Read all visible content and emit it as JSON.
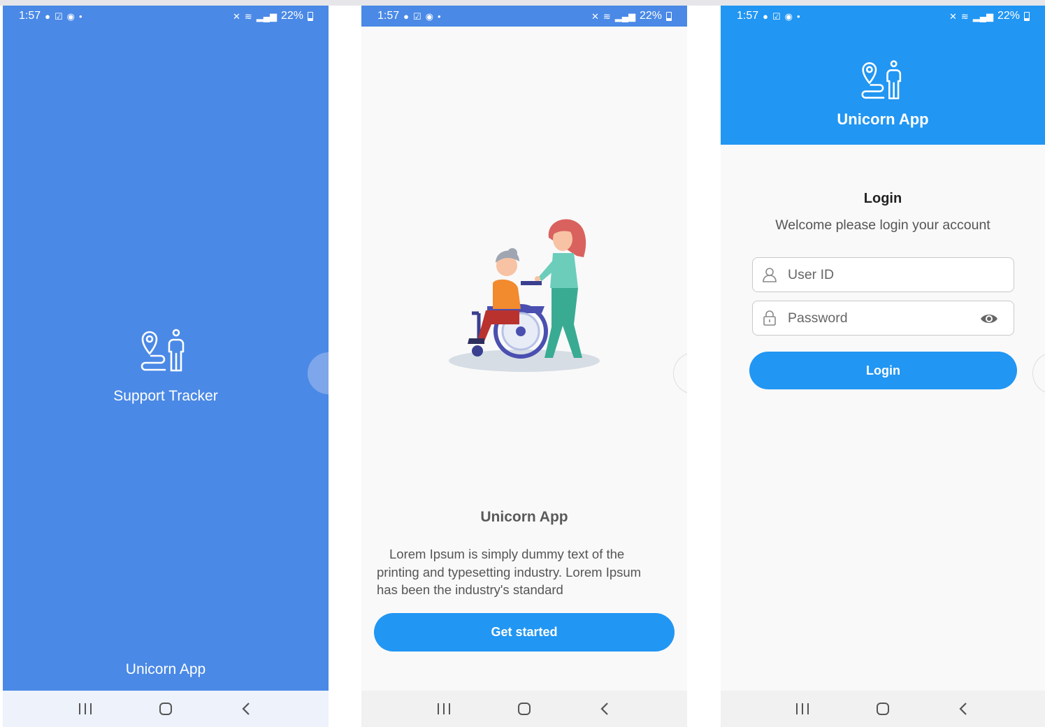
{
  "status": {
    "time": "1:57",
    "battery": "22%"
  },
  "splash": {
    "title": "Support Tracker",
    "footer": "Unicorn App"
  },
  "onboarding": {
    "title": "Unicorn App",
    "description": "Lorem Ipsum is simply dummy text of the printing and typesetting industry. Lorem Ipsum has been the industry's standard",
    "button_label": "Get started"
  },
  "login": {
    "app_name": "Unicorn App",
    "heading": "Login",
    "subheading": "Welcome please login your account",
    "userid_placeholder": "User ID",
    "password_placeholder": "Password",
    "button_label": "Login"
  },
  "colors": {
    "splash_bg": "#4a89e6",
    "primary": "#2196f3",
    "page_bg": "#f9f9f9"
  },
  "icons": [
    "location-person-logo-icon",
    "eye-icon",
    "user-icon",
    "lock-icon",
    "recent-apps-icon",
    "home-icon",
    "back-icon"
  ]
}
